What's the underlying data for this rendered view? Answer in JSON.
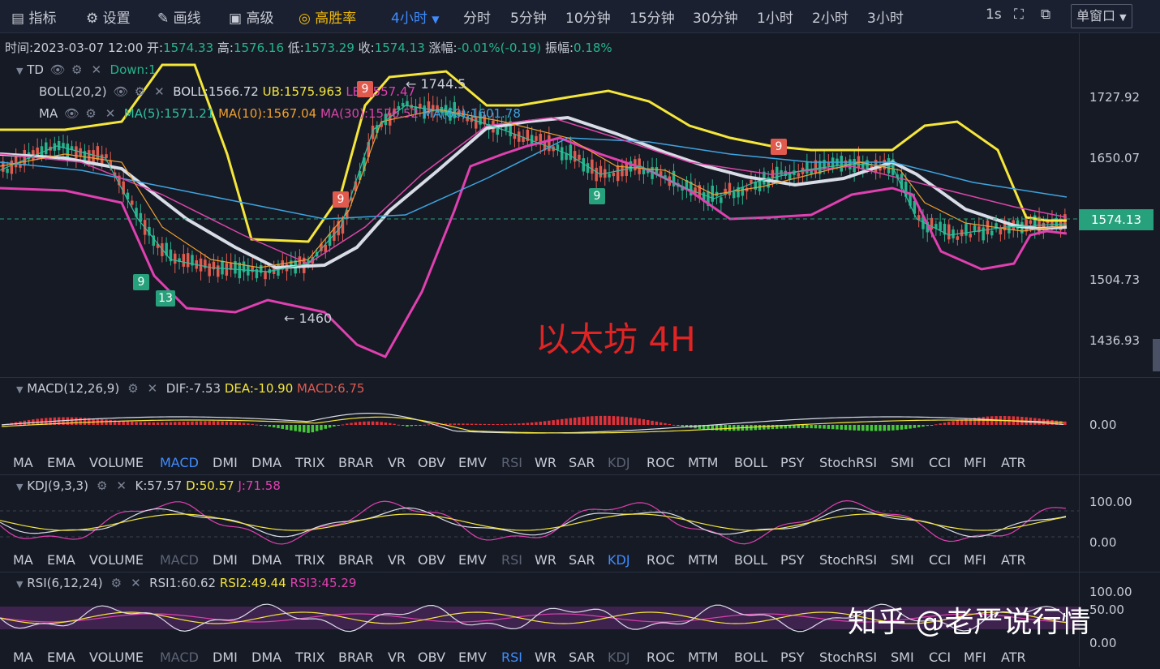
{
  "toolbar": {
    "indicators": "指标",
    "settings": "设置",
    "draw": "画线",
    "advanced": "高级",
    "winrate": "高胜率",
    "interval_active": "4小时",
    "intervals": [
      "分时",
      "5分钟",
      "10分钟",
      "15分钟",
      "30分钟",
      "1小时",
      "2小时",
      "3小时"
    ],
    "second": "1s",
    "window_mode": "单窗口"
  },
  "ohlc": {
    "time_label": "时间:",
    "time": "2023-03-07 12:00",
    "open_label": "开:",
    "open": "1574.33",
    "high_label": "高:",
    "high": "1576.16",
    "low_label": "低:",
    "low": "1573.29",
    "close_label": "收:",
    "close": "1574.13",
    "change_label": "涨幅:",
    "change": "-0.01%(-0.19)",
    "amp_label": "振幅:",
    "amp": "0.18%"
  },
  "main_indicators": {
    "td": {
      "name": "TD",
      "value": "Down:1"
    },
    "boll": {
      "name": "BOLL(20,2)",
      "boll": "BOLL:1566.72",
      "ub": "UB:1575.963",
      "lb": "LB:1557.47"
    },
    "ma": {
      "name": "MA",
      "ma5": "MA(5):1571.21",
      "ma10": "MA(10):1567.04",
      "ma30": "MA(30):1576.52",
      "ma60": "MA(60):1601.78"
    }
  },
  "price_axis": {
    "p1": "1727.92",
    "p2": "1650.07",
    "p3": "1504.73",
    "p4": "1436.93",
    "current": "1574.13"
  },
  "annotations": {
    "high": "← 1744.5",
    "low": "← 1460",
    "title": "以太坊 4H",
    "badges": [
      "9",
      "13",
      "9",
      "9",
      "9",
      "9"
    ]
  },
  "macd": {
    "name": "MACD(12,26,9)",
    "dif": "DIF:-7.53",
    "dea": "DEA:-10.90",
    "macd": "MACD:6.75",
    "axis_zero": "0.00"
  },
  "kdj": {
    "name": "KDJ(9,3,3)",
    "k": "K:57.57",
    "d": "D:50.57",
    "j": "J:71.58",
    "axis_top": "100.00",
    "axis_bottom": "0.00"
  },
  "rsi": {
    "name": "RSI(6,12,24)",
    "r1": "RSI1:60.62",
    "r2": "RSI2:49.44",
    "r3": "RSI3:45.29",
    "axis_top": "100.00",
    "axis_mid": "50.00",
    "axis_bottom": "0.00"
  },
  "indicator_tabs": [
    "MA",
    "EMA",
    "VOLUME",
    "MACD",
    "DMI",
    "DMA",
    "TRIX",
    "BRAR",
    "VR",
    "OBV",
    "EMV",
    "RSI",
    "WR",
    "SAR",
    "KDJ",
    "ROC",
    "MTM",
    "BOLL",
    "PSY",
    "StochRSI",
    "SMI",
    "CCI",
    "MFI",
    "ATR"
  ],
  "watermark": "知乎 @老严说行情",
  "colors": {
    "bg": "#161a25",
    "up": "#26b38b",
    "down": "#e05a4e",
    "yellow": "#f5e63a",
    "pink": "#e040b0",
    "white": "#d8dce6",
    "blue": "#3f8cff",
    "gold": "#f0b90b"
  }
}
